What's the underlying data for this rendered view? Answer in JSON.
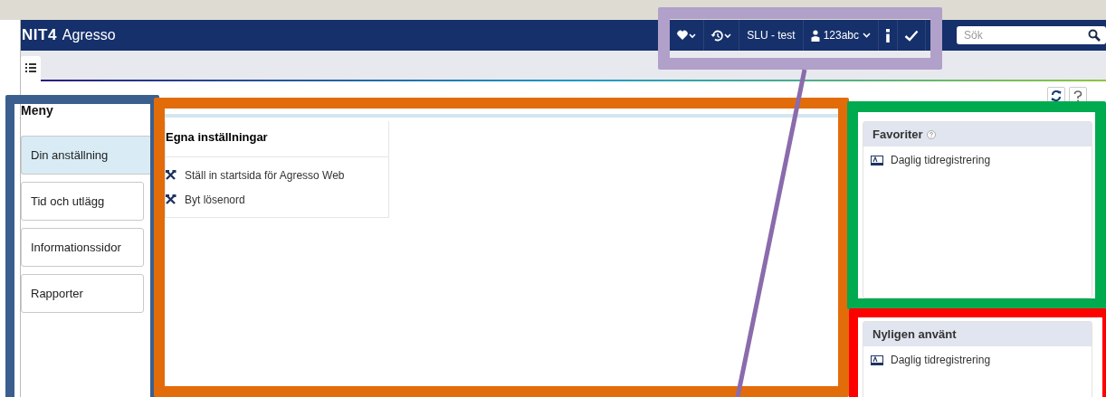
{
  "header": {
    "logo": "NIT4",
    "product": "Agresso",
    "environment": "SLU - test",
    "user": "123abc",
    "search": {
      "placeholder": "Sök"
    }
  },
  "tabs": [
    {
      "selected": true
    }
  ],
  "menu": {
    "title": "Meny",
    "items": [
      {
        "label": "Din anställning",
        "selected": true
      },
      {
        "label": "Tid och utlägg",
        "selected": false
      },
      {
        "label": "Informationssidor",
        "selected": false
      },
      {
        "label": "Rapporter",
        "selected": false
      }
    ]
  },
  "panel": {
    "title": "Egna inställningar",
    "links": [
      "Ställ in startsida för Agresso Web",
      "Byt lösenord"
    ]
  },
  "favorites": {
    "title": "Favoriter",
    "items": [
      "Daglig tidregistrering"
    ]
  },
  "recent": {
    "title": "Nyligen använt",
    "items": [
      "Daglig tidregistrering"
    ]
  },
  "annotations": [
    {
      "color": "#b1a0c9"
    },
    {
      "color": "#3a5f8f"
    },
    {
      "color": "#e36c0a"
    },
    {
      "color": "#00aa4f"
    },
    {
      "color": "#ff0000"
    }
  ]
}
